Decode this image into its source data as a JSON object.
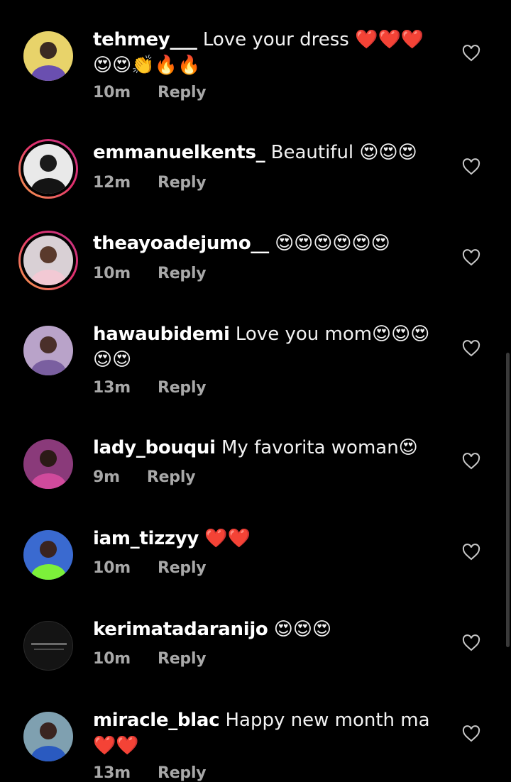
{
  "comments": [
    {
      "username": "tehmey___",
      "text": "Love your dress ❤️❤️❤️😍😍👏🔥🔥",
      "time": "10m",
      "reply_label": "Reply"
    },
    {
      "username": "emmanuelkents_",
      "text": "Beautiful 😍😍😍",
      "time": "12m",
      "reply_label": "Reply"
    },
    {
      "username": "theayoadejumo__",
      "text": "😍😍😍😍😍😍",
      "time": "10m",
      "reply_label": "Reply"
    },
    {
      "username": "hawaubidemi",
      "text": "Love you mom😍😍😍😍😍",
      "time": "13m",
      "reply_label": "Reply"
    },
    {
      "username": "lady_bouqui",
      "text": "My favorita woman😍",
      "time": "9m",
      "reply_label": "Reply"
    },
    {
      "username": "iam_tizzyy",
      "text": "❤️❤️",
      "time": "10m",
      "reply_label": "Reply"
    },
    {
      "username": "kerimatadaranijo",
      "text": "😍😍😍",
      "time": "10m",
      "reply_label": "Reply"
    },
    {
      "username": "miracle_blac",
      "text": "Happy new month ma❤️❤️",
      "time": "13m",
      "reply_label": "Reply"
    }
  ],
  "icons": {
    "like": "heart-outline-icon"
  },
  "colors": {
    "background": "#000000",
    "meta_text": "#a8a8a8",
    "story_ring_start": "#f9a34d",
    "story_ring_end": "#c13584"
  }
}
